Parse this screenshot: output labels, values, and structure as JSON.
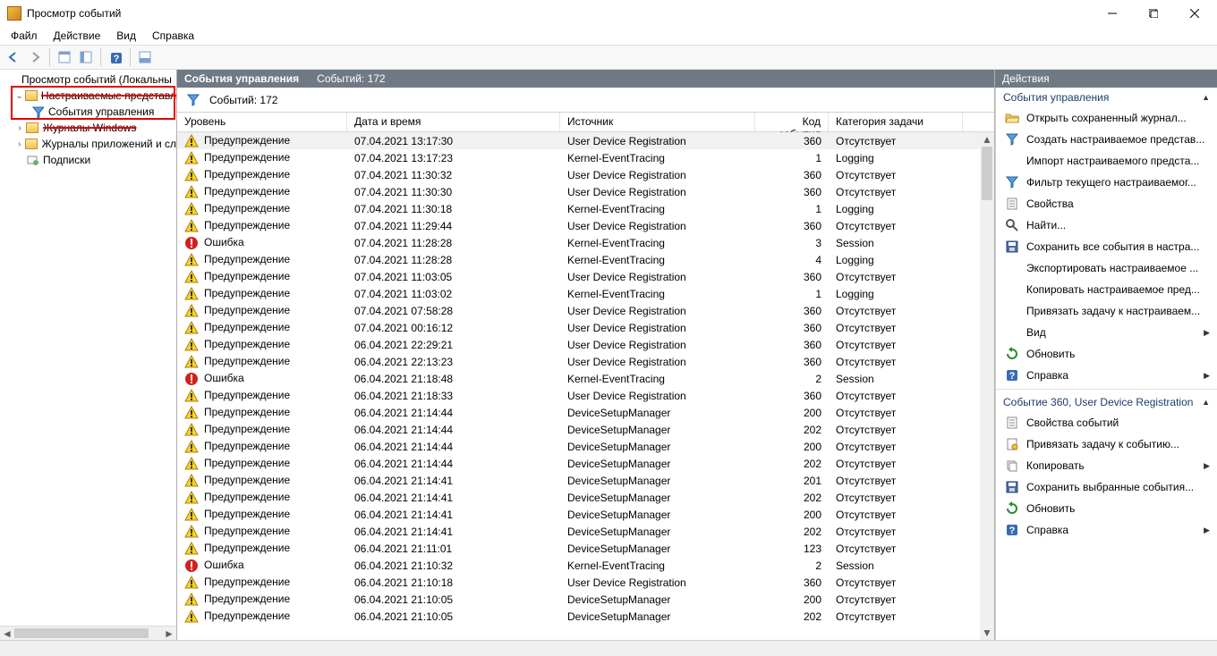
{
  "window": {
    "title": "Просмотр событий"
  },
  "menu": {
    "file": "Файл",
    "action": "Действие",
    "view": "Вид",
    "help": "Справка"
  },
  "tree": {
    "root": "Просмотр событий (Локальны",
    "custom": "Настраиваемые представл",
    "admin": "События управления",
    "winlogs": "Журналы Windows",
    "applogs": "Журналы приложений и сл",
    "subs": "Подписки"
  },
  "center": {
    "title": "События управления",
    "count_header": "Событий: 172",
    "filter_count": "Событий: 172",
    "columns": {
      "level": "Уровень",
      "date": "Дата и время",
      "source": "Источник",
      "id": "Код события",
      "cat": "Категория задачи"
    }
  },
  "events": [
    {
      "level": "Предупреждение",
      "date": "07.04.2021 13:17:30",
      "source": "User Device Registration",
      "id": 360,
      "cat": "Отсутствует",
      "sel": true
    },
    {
      "level": "Предупреждение",
      "date": "07.04.2021 13:17:23",
      "source": "Kernel-EventTracing",
      "id": 1,
      "cat": "Logging"
    },
    {
      "level": "Предупреждение",
      "date": "07.04.2021 11:30:32",
      "source": "User Device Registration",
      "id": 360,
      "cat": "Отсутствует"
    },
    {
      "level": "Предупреждение",
      "date": "07.04.2021 11:30:30",
      "source": "User Device Registration",
      "id": 360,
      "cat": "Отсутствует"
    },
    {
      "level": "Предупреждение",
      "date": "07.04.2021 11:30:18",
      "source": "Kernel-EventTracing",
      "id": 1,
      "cat": "Logging"
    },
    {
      "level": "Предупреждение",
      "date": "07.04.2021 11:29:44",
      "source": "User Device Registration",
      "id": 360,
      "cat": "Отсутствует"
    },
    {
      "level": "Ошибка",
      "date": "07.04.2021 11:28:28",
      "source": "Kernel-EventTracing",
      "id": 3,
      "cat": "Session"
    },
    {
      "level": "Предупреждение",
      "date": "07.04.2021 11:28:28",
      "source": "Kernel-EventTracing",
      "id": 4,
      "cat": "Logging"
    },
    {
      "level": "Предупреждение",
      "date": "07.04.2021 11:03:05",
      "source": "User Device Registration",
      "id": 360,
      "cat": "Отсутствует"
    },
    {
      "level": "Предупреждение",
      "date": "07.04.2021 11:03:02",
      "source": "Kernel-EventTracing",
      "id": 1,
      "cat": "Logging"
    },
    {
      "level": "Предупреждение",
      "date": "07.04.2021 07:58:28",
      "source": "User Device Registration",
      "id": 360,
      "cat": "Отсутствует"
    },
    {
      "level": "Предупреждение",
      "date": "07.04.2021 00:16:12",
      "source": "User Device Registration",
      "id": 360,
      "cat": "Отсутствует"
    },
    {
      "level": "Предупреждение",
      "date": "06.04.2021 22:29:21",
      "source": "User Device Registration",
      "id": 360,
      "cat": "Отсутствует"
    },
    {
      "level": "Предупреждение",
      "date": "06.04.2021 22:13:23",
      "source": "User Device Registration",
      "id": 360,
      "cat": "Отсутствует"
    },
    {
      "level": "Ошибка",
      "date": "06.04.2021 21:18:48",
      "source": "Kernel-EventTracing",
      "id": 2,
      "cat": "Session"
    },
    {
      "level": "Предупреждение",
      "date": "06.04.2021 21:18:33",
      "source": "User Device Registration",
      "id": 360,
      "cat": "Отсутствует"
    },
    {
      "level": "Предупреждение",
      "date": "06.04.2021 21:14:44",
      "source": "DeviceSetupManager",
      "id": 200,
      "cat": "Отсутствует"
    },
    {
      "level": "Предупреждение",
      "date": "06.04.2021 21:14:44",
      "source": "DeviceSetupManager",
      "id": 202,
      "cat": "Отсутствует"
    },
    {
      "level": "Предупреждение",
      "date": "06.04.2021 21:14:44",
      "source": "DeviceSetupManager",
      "id": 200,
      "cat": "Отсутствует"
    },
    {
      "level": "Предупреждение",
      "date": "06.04.2021 21:14:44",
      "source": "DeviceSetupManager",
      "id": 202,
      "cat": "Отсутствует"
    },
    {
      "level": "Предупреждение",
      "date": "06.04.2021 21:14:41",
      "source": "DeviceSetupManager",
      "id": 201,
      "cat": "Отсутствует"
    },
    {
      "level": "Предупреждение",
      "date": "06.04.2021 21:14:41",
      "source": "DeviceSetupManager",
      "id": 202,
      "cat": "Отсутствует"
    },
    {
      "level": "Предупреждение",
      "date": "06.04.2021 21:14:41",
      "source": "DeviceSetupManager",
      "id": 200,
      "cat": "Отсутствует"
    },
    {
      "level": "Предупреждение",
      "date": "06.04.2021 21:14:41",
      "source": "DeviceSetupManager",
      "id": 202,
      "cat": "Отсутствует"
    },
    {
      "level": "Предупреждение",
      "date": "06.04.2021 21:11:01",
      "source": "DeviceSetupManager",
      "id": 123,
      "cat": "Отсутствует"
    },
    {
      "level": "Ошибка",
      "date": "06.04.2021 21:10:32",
      "source": "Kernel-EventTracing",
      "id": 2,
      "cat": "Session"
    },
    {
      "level": "Предупреждение",
      "date": "06.04.2021 21:10:18",
      "source": "User Device Registration",
      "id": 360,
      "cat": "Отсутствует"
    },
    {
      "level": "Предупреждение",
      "date": "06.04.2021 21:10:05",
      "source": "DeviceSetupManager",
      "id": 200,
      "cat": "Отсутствует"
    },
    {
      "level": "Предупреждение",
      "date": "06.04.2021 21:10:05",
      "source": "DeviceSetupManager",
      "id": 202,
      "cat": "Отсутствует"
    }
  ],
  "actions": {
    "title": "Действия",
    "section1": "События управления",
    "section2": "Событие 360, User Device Registration",
    "items1": [
      {
        "icon": "open",
        "text": "Открыть сохраненный журнал..."
      },
      {
        "icon": "funnel-new",
        "text": "Создать настраиваемое представ..."
      },
      {
        "icon": "none",
        "text": "Импорт настраиваемого предста..."
      },
      {
        "icon": "funnel",
        "text": "Фильтр текущего настраиваемог..."
      },
      {
        "icon": "props",
        "text": "Свойства"
      },
      {
        "icon": "find",
        "text": "Найти..."
      },
      {
        "icon": "save",
        "text": "Сохранить все события в настра..."
      },
      {
        "icon": "none",
        "text": "Экспортировать настраиваемое ..."
      },
      {
        "icon": "none",
        "text": "Копировать настраиваемое пред..."
      },
      {
        "icon": "none",
        "text": "Привязать задачу к настраиваем..."
      },
      {
        "icon": "none",
        "text": "Вид",
        "expand": true
      },
      {
        "icon": "refresh",
        "text": "Обновить"
      },
      {
        "icon": "help",
        "text": "Справка",
        "expand": true
      }
    ],
    "items2": [
      {
        "icon": "props",
        "text": "Свойства событий"
      },
      {
        "icon": "attach",
        "text": "Привязать задачу к событию..."
      },
      {
        "icon": "copy",
        "text": "Копировать",
        "expand": true
      },
      {
        "icon": "save",
        "text": "Сохранить выбранные события..."
      },
      {
        "icon": "refresh",
        "text": "Обновить"
      },
      {
        "icon": "help",
        "text": "Справка",
        "expand": true
      }
    ]
  }
}
